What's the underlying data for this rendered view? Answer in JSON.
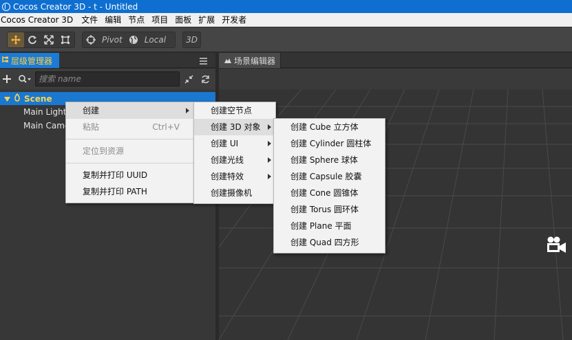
{
  "window": {
    "title": "Cocos Creator 3D - t - Untitled"
  },
  "menubar": {
    "items": [
      "Cocos Creator 3D",
      "文件",
      "编辑",
      "节点",
      "项目",
      "面板",
      "扩展",
      "开发者"
    ]
  },
  "toolbar": {
    "pivot_label": "Pivot",
    "local_label": "Local",
    "mode_3d_label": "3D"
  },
  "hierarchy": {
    "tab_title": "层级管理器",
    "search_placeholder": "搜索 name",
    "tree": {
      "scene": "Scene",
      "children": [
        "Main Light",
        "Main Camera"
      ]
    }
  },
  "scene_editor": {
    "tab_title": "场景编辑器"
  },
  "context_menu": {
    "create": "创建",
    "paste": "粘贴",
    "paste_shortcut": "Ctrl+V",
    "locate_asset": "定位到资源",
    "copy_uuid": "复制并打印 UUID",
    "copy_path": "复制并打印 PATH"
  },
  "create_menu": {
    "empty_node": "创建空节点",
    "object_3d": "创建 3D 对象",
    "ui": "创建 UI",
    "light": "创建光线",
    "effects": "创建特效",
    "camera": "创建摄像机"
  },
  "object_3d_menu": {
    "cube": "创建 Cube 立方体",
    "cylinder": "创建 Cylinder 圆柱体",
    "sphere": "创建 Sphere 球体",
    "capsule": "创建 Capsule 胶囊",
    "cone": "创建 Cone 圆锥体",
    "torus": "创建 Torus 圆环体",
    "plane": "创建 Plane 平面",
    "quad": "创建 Quad 四方形"
  },
  "colors": {
    "titlebar": "#0f6fd0",
    "selection": "#1b78d0",
    "scene_label": "#ffd24a",
    "panel_bg": "#373737"
  }
}
